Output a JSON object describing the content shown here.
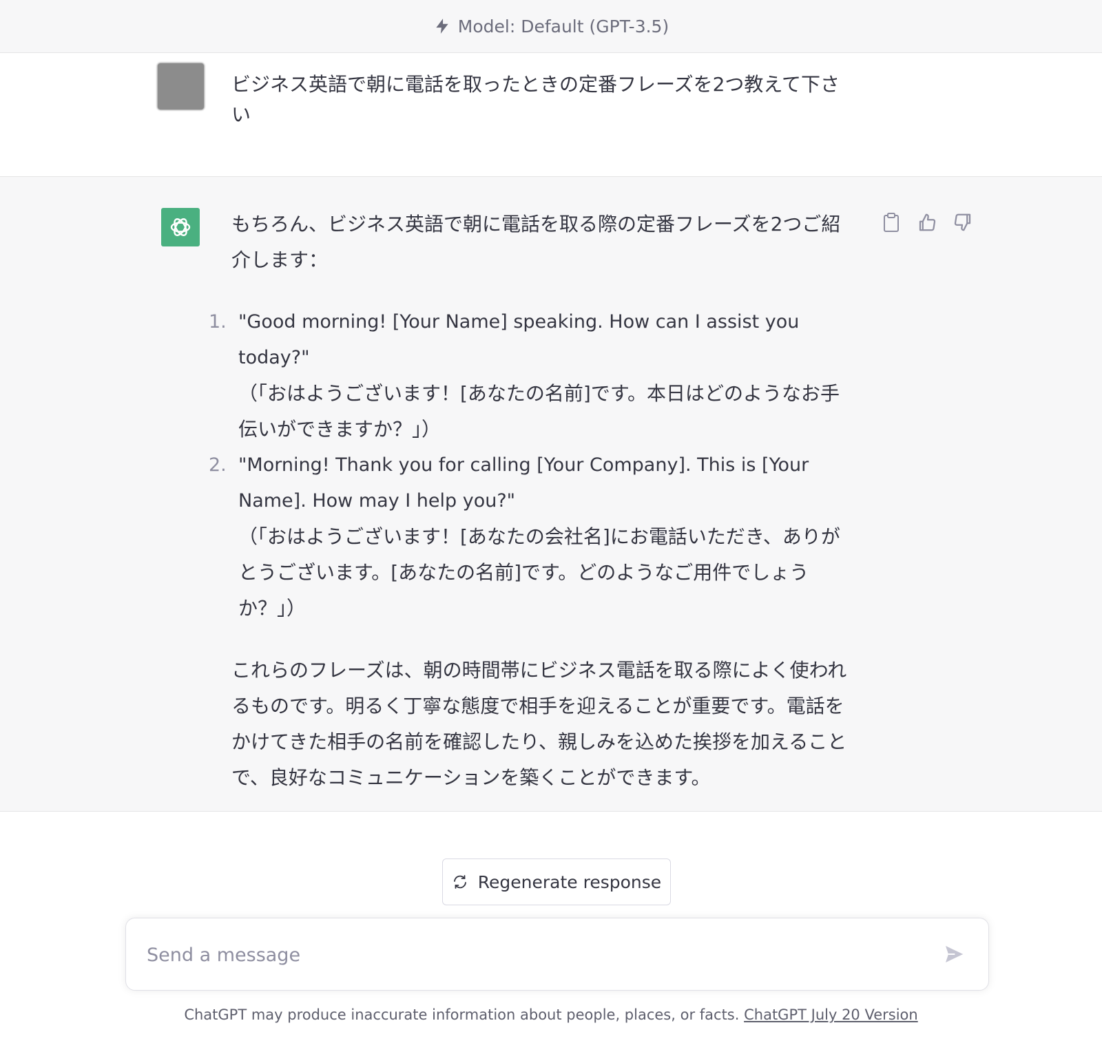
{
  "header": {
    "model_label": "Model: Default (GPT-3.5)",
    "icon": "lightning-bolt-icon"
  },
  "user_message": {
    "text": "ビジネス英語で朝に電話を取ったときの定番フレーズを2つ教えて下さい"
  },
  "assistant_message": {
    "intro": "もちろん、ビジネス英語で朝に電話を取る際の定番フレーズを2つご紹介します：",
    "items": [
      {
        "number": "1.",
        "english": "\"Good morning! [Your Name] speaking. How can I assist you today?\"",
        "japanese": "（「おはようございます！[あなたの名前]です。本日はどのようなお手伝いができますか？」）"
      },
      {
        "number": "2.",
        "english": "\"Morning! Thank you for calling [Your Company]. This is [Your Name]. How may I help you?\"",
        "japanese": "（「おはようございます！[あなたの会社名]にお電話いただき、ありがとうございます。[あなたの名前]です。どのようなご用件でしょうか？」）"
      }
    ],
    "closing": "これらのフレーズは、朝の時間帯にビジネス電話を取る際によく使われるものです。明るく丁寧な態度で相手を迎えることが重要です。電話をかけてきた相手の名前を確認したり、親しみを込めた挨拶を加えることで、良好なコミュニケーションを築くことができます。",
    "action_icons": [
      "clipboard-icon",
      "thumbs-up-icon",
      "thumbs-down-icon"
    ]
  },
  "regenerate": {
    "label": "Regenerate response"
  },
  "composer": {
    "placeholder": "Send a message"
  },
  "footer": {
    "disclaimer": "ChatGPT may produce inaccurate information about people, places, or facts.",
    "version_link": "ChatGPT July 20 Version"
  },
  "colors": {
    "accent": "#19c37d",
    "text": "#343541",
    "muted": "#8e8ea0",
    "panel": "#f7f7f8"
  }
}
